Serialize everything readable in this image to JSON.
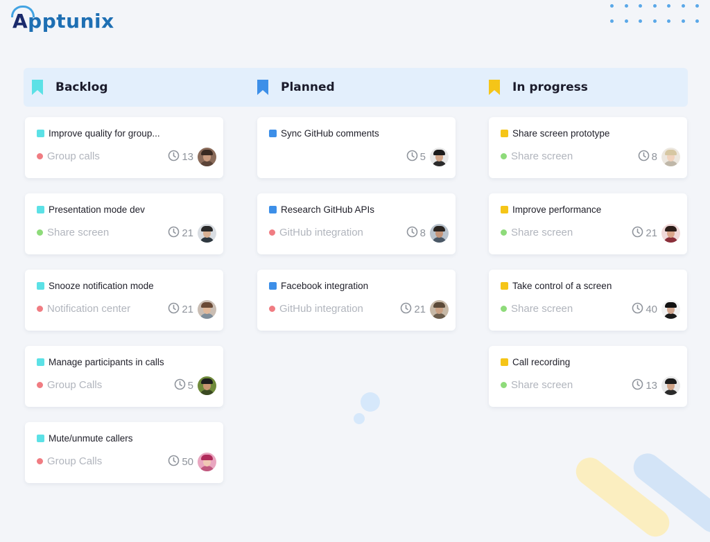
{
  "brand": {
    "logo_text": "Apptunix",
    "logo_first": "A",
    "logo_rest": "pptunix"
  },
  "colors": {
    "backlog": "#5ce1e6",
    "planned": "#3d8fe8",
    "in_progress": "#f5c518",
    "dot_red": "#f07c82",
    "dot_green": "#8edb7a"
  },
  "columns": [
    {
      "title": "Backlog",
      "icon": "bookmark-icon",
      "cards": [
        {
          "title": "Improve quality for group...",
          "tag": "Group calls",
          "tag_color": "red",
          "count": "13",
          "avatar": "avatar-man-brown"
        },
        {
          "title": "Presentation mode dev",
          "tag": "Share screen",
          "tag_color": "green",
          "count": "21",
          "avatar": "avatar-man-dark"
        },
        {
          "title": "Snooze notification mode",
          "tag": "Notification center",
          "tag_color": "red",
          "count": "21",
          "avatar": "avatar-woman-brown"
        },
        {
          "title": "Manage participants in calls",
          "tag": "Group Calls",
          "tag_color": "red",
          "count": "5",
          "avatar": "avatar-man-green"
        },
        {
          "title": "Mute/unmute callers",
          "tag": "Group Calls",
          "tag_color": "red",
          "count": "50",
          "avatar": "avatar-woman-pink"
        }
      ]
    },
    {
      "title": "Planned",
      "icon": "bookmark-icon",
      "cards": [
        {
          "title": "Sync GitHub comments",
          "tag": "",
          "tag_color": "",
          "count": "5",
          "avatar": "avatar-man-cap"
        },
        {
          "title": "Research GitHub APIs",
          "tag": "GitHub integration",
          "tag_color": "red",
          "count": "8",
          "avatar": "avatar-man-beard"
        },
        {
          "title": "Facebook integration",
          "tag": "GitHub integration",
          "tag_color": "red",
          "count": "21",
          "avatar": "avatar-man-hat"
        }
      ]
    },
    {
      "title": "In progress",
      "icon": "bookmark-icon",
      "cards": [
        {
          "title": "Share screen prototype",
          "tag": "Share screen",
          "tag_color": "green",
          "count": "8",
          "avatar": "avatar-woman-blonde"
        },
        {
          "title": "Improve performance",
          "tag": "Share screen",
          "tag_color": "green",
          "count": "21",
          "avatar": "avatar-woman-dark"
        },
        {
          "title": "Take control of a screen",
          "tag": "Share screen",
          "tag_color": "green",
          "count": "40",
          "avatar": "avatar-woman-black"
        },
        {
          "title": "Call recording",
          "tag": "Share screen",
          "tag_color": "green",
          "count": "13",
          "avatar": "avatar-man-cap"
        }
      ]
    }
  ]
}
